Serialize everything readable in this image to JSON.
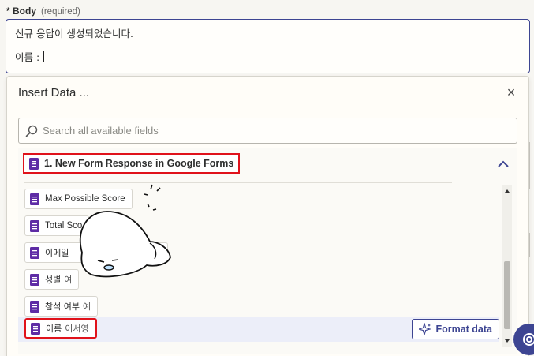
{
  "field": {
    "label": "* Body",
    "required_note": "(required)",
    "line1": "신규 응답이 생성되었습니다.",
    "line2": "이름 : "
  },
  "panel": {
    "title": "Insert Data ...",
    "close_glyph": "×",
    "search_placeholder": "Search all available fields",
    "step_label": "1. New Form Response in Google Forms",
    "items": [
      {
        "label": "Max Possible Score",
        "value": ""
      },
      {
        "label": "Total Sco",
        "value": ""
      },
      {
        "label": "이메일",
        "value": ""
      },
      {
        "label": "성별",
        "value": "여"
      },
      {
        "label": "참석 여부",
        "value": "예"
      },
      {
        "label": "이름",
        "value": "이서영"
      }
    ],
    "format_button": "Format data"
  },
  "colors": {
    "accent": "#3d4592",
    "highlight_red": "#e0121b",
    "forms_purple": "#5e2ca5"
  }
}
